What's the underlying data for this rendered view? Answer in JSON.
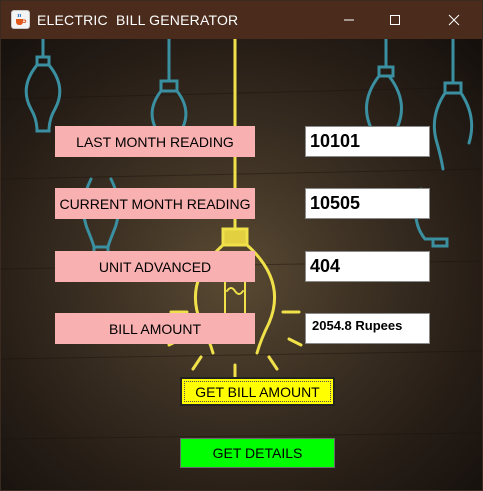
{
  "window": {
    "title": "ELECTRIC  BILL GENERATOR",
    "app_icon": "java-coffee-cup-icon",
    "controls": {
      "minimize": "minimize-icon",
      "maximize": "maximize-icon",
      "close": "close-icon"
    }
  },
  "form": {
    "last_month": {
      "label": "LAST MONTH READING",
      "value": "10101"
    },
    "current_month": {
      "label": "CURRENT MONTH READING",
      "value": "10505"
    },
    "unit_advanced": {
      "label": "UNIT ADVANCED",
      "value": "404"
    },
    "bill_amount": {
      "label": "BILL AMOUNT",
      "value": "2054.8 Rupees"
    }
  },
  "buttons": {
    "get_bill_amount": "GET BILL AMOUNT",
    "get_details": "GET DETAILS"
  },
  "colors": {
    "titlebar": "#4a2b1c",
    "label_bg": "#f9b0b0",
    "bill_button": "#ffff00",
    "details_button": "#00ff00",
    "bulb_yellow": "#f0e04a",
    "bulb_blue": "#3a8fa0"
  }
}
